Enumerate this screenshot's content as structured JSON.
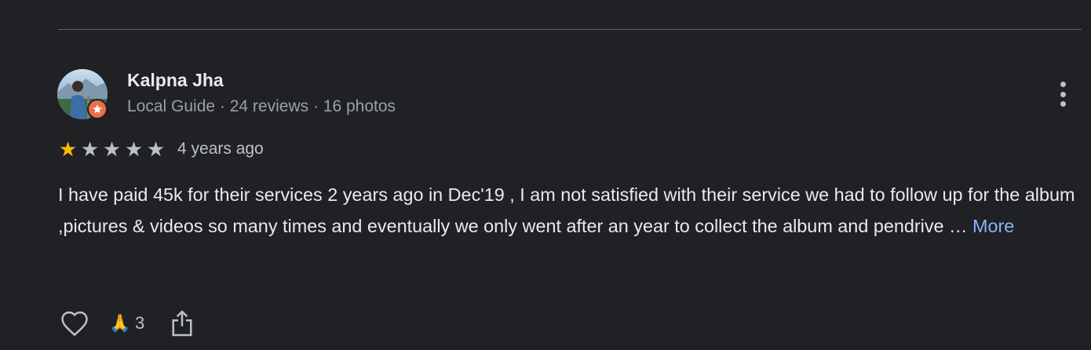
{
  "reviewer": {
    "name": "Kalpna Jha",
    "meta": "Local Guide · 24 reviews · 16 photos"
  },
  "rating": {
    "stars": 1,
    "max": 5,
    "time": "4 years ago"
  },
  "review": {
    "text": "I have paid 45k for their services 2 years ago in Dec'19 , I am not satisfied with their service we had to follow up for the album ,pictures & videos so many times and eventually we only went after an year to collect the album and pendrive …",
    "more_label": "More"
  },
  "actions": {
    "like_icon": "heart-outline-icon",
    "helpful_icon": "folded-hands-icon",
    "helpful_emoji": "🙏",
    "helpful_count": "3",
    "share_icon": "share-icon"
  },
  "colors": {
    "background": "#202124",
    "star_on": "#fbbc04",
    "star_off": "#bdc1c6",
    "link": "#8ab4f8",
    "badge": "#e8704a"
  }
}
